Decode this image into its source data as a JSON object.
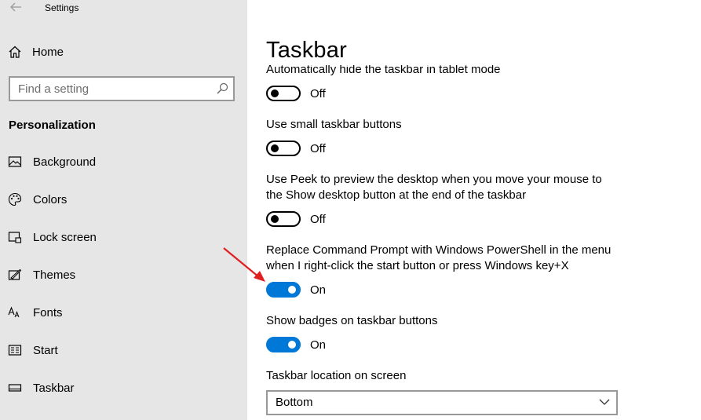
{
  "window": {
    "title": "Settings"
  },
  "sidebar": {
    "home_label": "Home",
    "search_placeholder": "Find a setting",
    "section_title": "Personalization",
    "items": [
      {
        "label": "Background",
        "icon": "picture-icon"
      },
      {
        "label": "Colors",
        "icon": "palette-icon"
      },
      {
        "label": "Lock screen",
        "icon": "lock-screen-icon"
      },
      {
        "label": "Themes",
        "icon": "themes-icon"
      },
      {
        "label": "Fonts",
        "icon": "fonts-icon"
      },
      {
        "label": "Start",
        "icon": "start-icon"
      },
      {
        "label": "Taskbar",
        "icon": "taskbar-icon"
      }
    ]
  },
  "main": {
    "title": "Taskbar",
    "settings": [
      {
        "label": "Automatically hide the taskbar in tablet mode",
        "state": "Off"
      },
      {
        "label": "Use small taskbar buttons",
        "state": "Off"
      },
      {
        "label": "Use Peek to preview the desktop when you move your mouse to the Show desktop button at the end of the taskbar",
        "state": "Off"
      },
      {
        "label": "Replace Command Prompt with Windows PowerShell in the menu when I right-click the start button or press Windows key+X",
        "state": "On"
      },
      {
        "label": "Show badges on taskbar buttons",
        "state": "On"
      }
    ],
    "location": {
      "label": "Taskbar location on screen",
      "value": "Bottom"
    }
  },
  "colors": {
    "accent": "#0078d7",
    "sidebar_bg": "#e6e6e6",
    "annotation_arrow": "#e02020"
  }
}
